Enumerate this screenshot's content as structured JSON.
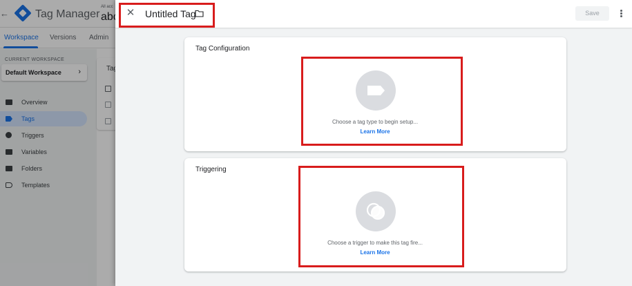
{
  "app": {
    "back_glyph": "←",
    "product_name": "Tag Manager",
    "account_label": "All acc",
    "account_name": "abc",
    "tabs": [
      {
        "label": "Workspace",
        "active": true
      },
      {
        "label": "Versions",
        "active": false
      },
      {
        "label": "Admin",
        "active": false
      }
    ],
    "sidebar": {
      "workspace_label": "CURRENT WORKSPACE",
      "workspace_name": "Default Workspace",
      "items": [
        {
          "label": "Overview",
          "icon": "briefcase-icon",
          "active": false
        },
        {
          "label": "Tags",
          "icon": "tag-icon",
          "active": true
        },
        {
          "label": "Triggers",
          "icon": "trigger-icon",
          "active": false
        },
        {
          "label": "Variables",
          "icon": "variables-icon",
          "active": false
        },
        {
          "label": "Folders",
          "icon": "folder-icon",
          "active": false
        },
        {
          "label": "Templates",
          "icon": "template-icon",
          "active": false
        }
      ]
    },
    "panel_title": "Tag"
  },
  "dialog": {
    "title": "Untitled Tag",
    "save_label": "Save",
    "tag_configuration": {
      "title": "Tag Configuration",
      "prompt": "Choose a tag type to begin setup...",
      "link": "Learn More",
      "icon": "tag-icon"
    },
    "triggering": {
      "title": "Triggering",
      "prompt": "Choose a trigger to make this tag fire...",
      "link": "Learn More",
      "icon": "trigger-icon"
    }
  },
  "colors": {
    "accent": "#1a73e8",
    "highlight": "#d81c1c",
    "placeholder_circle": "#dadce0"
  }
}
